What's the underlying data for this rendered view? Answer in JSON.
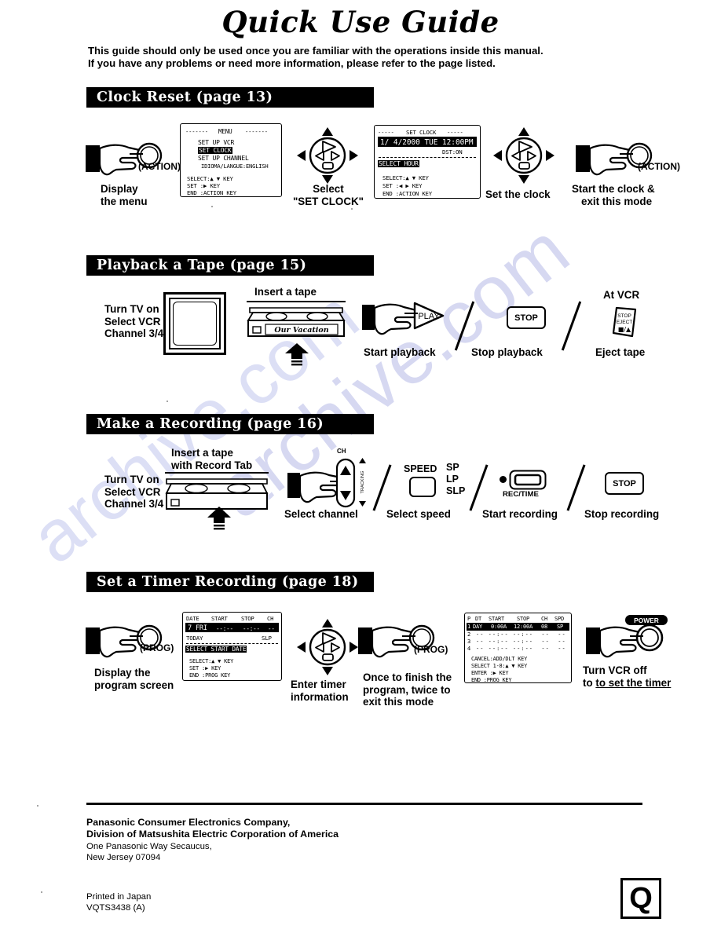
{
  "document": {
    "title": "Quick Use Guide",
    "intro_line1": "This guide should only be used once you are familiar with the operations inside this manual.",
    "intro_line2": "If you have any problems or need more information, please refer to the page listed.",
    "watermark": "archive.com"
  },
  "sections": [
    {
      "id": "clock-reset",
      "heading": "Clock Reset (page 13)",
      "steps": [
        {
          "label_line1": "Display",
          "label_line2": "the menu",
          "control": "(ACTION)"
        },
        {
          "label_line1": "Select",
          "label_line2": "\"SET CLOCK\""
        },
        {
          "label_line1": "Set the clock"
        },
        {
          "label_line1": "Start the clock &",
          "label_line2": "exit this mode",
          "control": "(ACTION)"
        }
      ],
      "osd_menu": {
        "header": "MENU",
        "items": [
          "SET UP VCR",
          "SET CLOCK",
          "SET UP CHANNEL",
          "IDIOMA/LANGUE:ENGLISH"
        ],
        "highlighted": "SET CLOCK",
        "help": [
          "SELECT:▲ ▼ KEY",
          "SET    :▶ KEY",
          "END    :ACTION KEY"
        ]
      },
      "osd_clock": {
        "header": "SET CLOCK",
        "datetime": "1/ 4/2000 TUE 12:00PM",
        "dst": "DST:ON",
        "prompt": "SELECT HOUR",
        "help": [
          "SELECT:▲ ▼ KEY",
          "SET   :◀ ▶ KEY",
          "END   :ACTION KEY"
        ]
      }
    },
    {
      "id": "playback-a-tape",
      "heading": "Playback a Tape (page 15)",
      "tv_caption": [
        "Turn TV on",
        "Select VCR",
        "Channel 3/4"
      ],
      "insert_caption": "Insert a tape",
      "tape_label": "Our Vacation",
      "steps": [
        {
          "label": "Start playback",
          "button": "PLAY"
        },
        {
          "label": "Stop playback",
          "button": "STOP"
        },
        {
          "label": "Eject tape",
          "button": "STOP/EJECT",
          "above": "At VCR"
        }
      ],
      "eject_button_lines": [
        "STOP",
        "EJECT",
        "■/▲"
      ]
    },
    {
      "id": "make-a-recording",
      "heading": "Make a Recording (page 16)",
      "tv_caption": [
        "Turn TV on",
        "Select VCR",
        "Channel 3/4"
      ],
      "insert_caption": [
        "Insert a tape",
        "with Record Tab"
      ],
      "channel": {
        "top_label": "CH",
        "side_label": "TRACKING",
        "caption": "Select channel"
      },
      "speed": {
        "button": "SPEED",
        "options": [
          "SP",
          "LP",
          "SLP"
        ],
        "caption": "Select speed"
      },
      "record": {
        "button": "REC/TIME",
        "caption": "Start recording"
      },
      "stop": {
        "button": "STOP",
        "caption": "Stop recording"
      }
    },
    {
      "id": "set-a-timer-recording",
      "heading": "Set a Timer Recording (page 18)",
      "steps": [
        {
          "label_line1": "Display the",
          "label_line2": "program screen",
          "control": "(PROG)"
        },
        {
          "label_line1": "Enter timer",
          "label_line2": "information"
        },
        {
          "label_line1": "Once to finish the",
          "label_line2": "program, twice to",
          "label_line3": "exit this mode",
          "control": "(PROG)"
        },
        {
          "label_line1": "Turn VCR off",
          "label_line2": "to set the timer",
          "control": "POWER"
        }
      ],
      "osd_program": {
        "columns": [
          "DATE",
          "START",
          "STOP",
          "CH"
        ],
        "row": {
          "date": "7 FRI",
          "start": "--:--",
          "stop": "--:--",
          "ch": "--"
        },
        "today": "TODAY",
        "speed": "SLP",
        "prompt": "SELECT START DATE",
        "help": [
          "SELECT:▲ ▼ KEY",
          "SET   :▶ KEY",
          "END   :PROG KEY"
        ]
      },
      "osd_timer_list": {
        "columns": [
          "P",
          "DT",
          "START",
          "STOP",
          "CH",
          "SPD"
        ],
        "rows": [
          {
            "p": "1",
            "dt": "DAY",
            "start": "0:00A",
            "stop": "12:00A",
            "ch": "08",
            "spd": "SP"
          },
          {
            "p": "2",
            "dt": "--",
            "start": "--:--",
            "stop": "--:--",
            "ch": "--",
            "spd": "--"
          },
          {
            "p": "3",
            "dt": "--",
            "start": "--:--",
            "stop": "--:--",
            "ch": "--",
            "spd": "--"
          },
          {
            "p": "4",
            "dt": "--",
            "start": "--:--",
            "stop": "--:--",
            "ch": "--",
            "spd": "--"
          }
        ],
        "help": [
          "CANCEL:ADD/DLT KEY",
          "SELECT 1-8:▲ ▼ KEY",
          "ENTER :▶ KEY",
          "END   :PROG KEY"
        ]
      }
    }
  ],
  "footer": {
    "company_line1": "Panasonic Consumer Electronics Company,",
    "company_line2": "Division of Matsushita Electric Corporation of America",
    "address_line1": "One Panasonic Way Secaucus,",
    "address_line2": "New Jersey 07094",
    "printed": "Printed in Japan",
    "code": "VQTS3438  (A)",
    "mark": "Q"
  }
}
